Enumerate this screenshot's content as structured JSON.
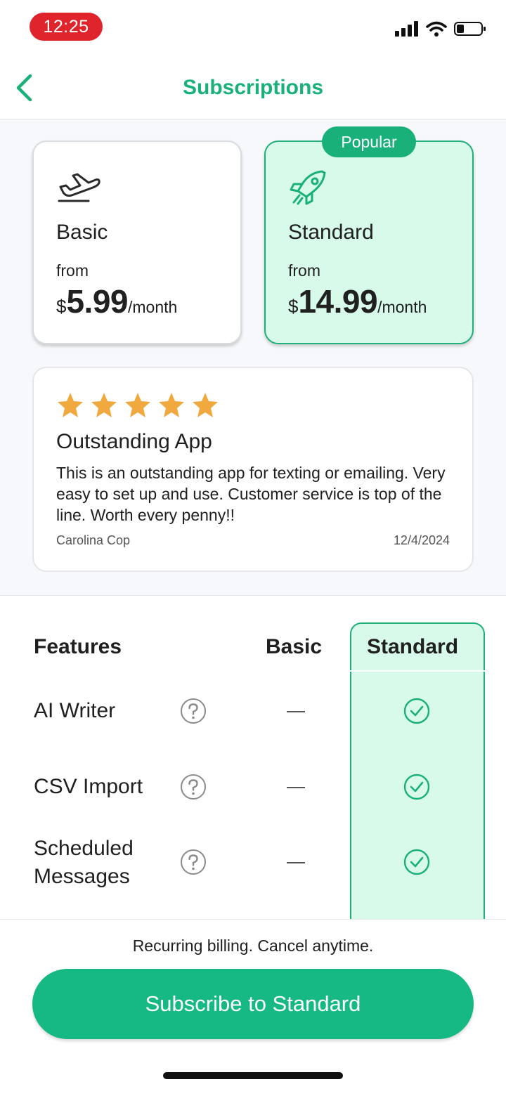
{
  "status": {
    "time": "12:25"
  },
  "nav": {
    "title": "Subscriptions"
  },
  "plans": [
    {
      "name": "Basic",
      "from": "from",
      "currency": "$",
      "amount": "5.99",
      "period": "/month",
      "icon": "plane-takeoff-icon"
    },
    {
      "name": "Standard",
      "from": "from",
      "currency": "$",
      "amount": "14.99",
      "period": "/month",
      "icon": "rocket-icon",
      "badge": "Popular"
    }
  ],
  "review": {
    "rating": 5,
    "title": "Outstanding App",
    "body": "This is an outstanding app for texting or emailing. Very easy to set up and use. Customer service is top of the line. Worth every penny!!",
    "author": "Carolina Cop",
    "date": "12/4/2024"
  },
  "features": {
    "header": "Features",
    "columns": [
      "Basic",
      "Standard"
    ],
    "rows": [
      {
        "label": "AI Writer",
        "basic": "—",
        "standard": "check"
      },
      {
        "label": "CSV Import",
        "basic": "—",
        "standard": "check"
      },
      {
        "label": "Scheduled\nMessages",
        "basic": "—",
        "standard": "check"
      }
    ]
  },
  "footer": {
    "billing_note": "Recurring billing. Cancel anytime.",
    "subscribe_label": "Subscribe to Standard"
  },
  "colors": {
    "accent": "#19b07a",
    "accent_light": "#d8faea",
    "star": "#f0a93e",
    "time_pill": "#e0242c"
  }
}
